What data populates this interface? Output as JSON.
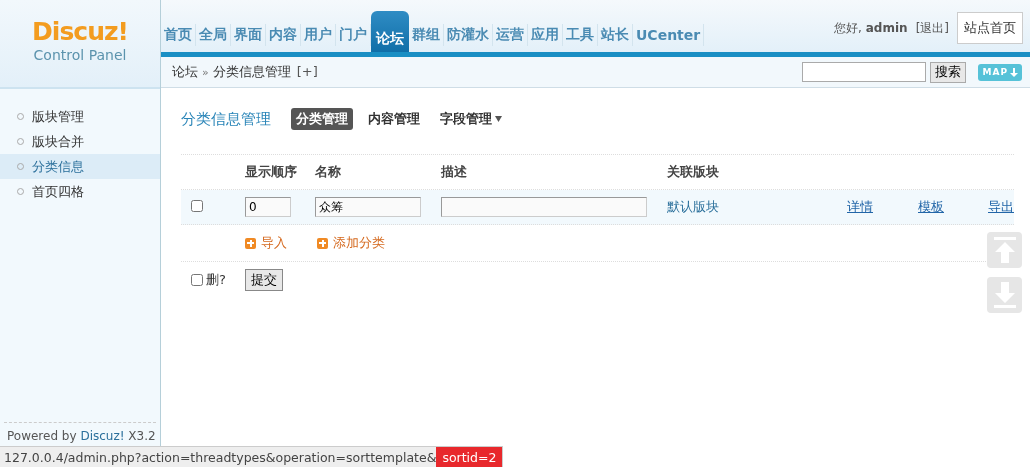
{
  "logo": {
    "name": "Discuz!",
    "subtitle": "Control Panel"
  },
  "nav": [
    {
      "label": "首页",
      "selected": false
    },
    {
      "label": "全局",
      "selected": false
    },
    {
      "label": "界面",
      "selected": false
    },
    {
      "label": "内容",
      "selected": false
    },
    {
      "label": "用户",
      "selected": false
    },
    {
      "label": "门户",
      "selected": false
    },
    {
      "label": "论坛",
      "selected": true
    },
    {
      "label": "群组",
      "selected": false
    },
    {
      "label": "防灌水",
      "selected": false
    },
    {
      "label": "运营",
      "selected": false
    },
    {
      "label": "应用",
      "selected": false
    },
    {
      "label": "工具",
      "selected": false
    },
    {
      "label": "站长",
      "selected": false
    },
    {
      "label": "UCenter",
      "selected": false
    }
  ],
  "user": {
    "greeting": "您好,",
    "name": "admin",
    "logout": "[退出]",
    "home_button": "站点首页"
  },
  "breadcrumb": {
    "parent": "论坛",
    "separator": "»",
    "current": "分类信息管理",
    "add": "[+]"
  },
  "search": {
    "button": "搜索",
    "map_button": "MAP"
  },
  "sidebar": {
    "items": [
      {
        "label": "版块管理",
        "selected": false
      },
      {
        "label": "版块合并",
        "selected": false
      },
      {
        "label": "分类信息",
        "selected": true
      },
      {
        "label": "首页四格",
        "selected": false
      }
    ],
    "footer": {
      "prefix": "Powered by",
      "brand": "Discuz!",
      "version": "X3.2"
    }
  },
  "page": {
    "title": "分类信息管理",
    "tabs": [
      {
        "label": "分类管理",
        "selected": true,
        "has_menu": false
      },
      {
        "label": "内容管理",
        "selected": false,
        "has_menu": false
      },
      {
        "label": "字段管理",
        "selected": false,
        "has_menu": true
      }
    ]
  },
  "table": {
    "columns": [
      "显示顺序",
      "名称",
      "描述",
      "关联版块"
    ],
    "rows": [
      {
        "checked": false,
        "order": "0",
        "name": "众筹",
        "forum": "默认版块",
        "actions": [
          "详情",
          "模板",
          "导出"
        ]
      }
    ],
    "add_links": [
      "导入",
      "添加分类"
    ],
    "delete": {
      "label": "删?",
      "checked": false
    },
    "submit": "提交"
  },
  "status_bar": {
    "url": "127.0.0.4/admin.php?action=threadtypes&operation=sorttemplate&",
    "highlight": "sortid=2"
  }
}
